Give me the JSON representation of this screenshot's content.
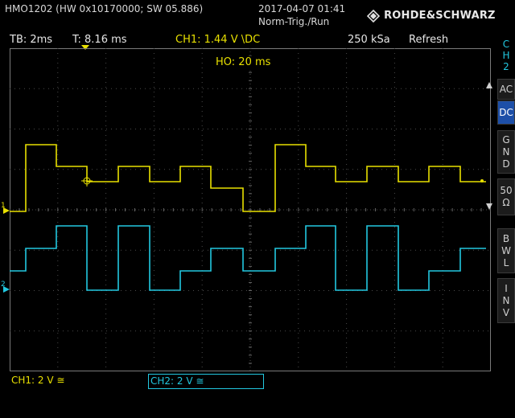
{
  "header": {
    "instrument": "HMO1202 (HW 0x10170000; SW 05.886)",
    "datetime": "2017-04-07 01:41",
    "trigger_mode": "Norm-Trig./Run",
    "brand": "ROHDE&SCHWARZ"
  },
  "status_bar": {
    "timebase": "TB: 2ms",
    "trigger_time": "T: 8.16 ms",
    "ch1_trigger": "CH1: 1.44 V \\DC",
    "sample_rate": "250 kSa",
    "mode": "Refresh"
  },
  "screen": {
    "holdoff": "HO:  20 ms",
    "ch1_marker": "1",
    "ch2_marker": "2",
    "colors": {
      "ch1": "#e8e000",
      "ch2": "#22c8e0",
      "grid": "#4a4a4a"
    }
  },
  "side_menu": {
    "channel": [
      "C",
      "H",
      "2"
    ],
    "coupling_ac": "AC",
    "coupling_dc": "DC",
    "gnd": [
      "G",
      "N",
      "D"
    ],
    "ohm50": [
      "50",
      "Ω"
    ],
    "bwl": [
      "B",
      "W",
      "L"
    ],
    "inv": [
      "I",
      "N",
      "V"
    ]
  },
  "bottom_bar": {
    "ch1": "CH1: 2 V ≅",
    "ch2": "CH2: 2 V ≅"
  }
}
